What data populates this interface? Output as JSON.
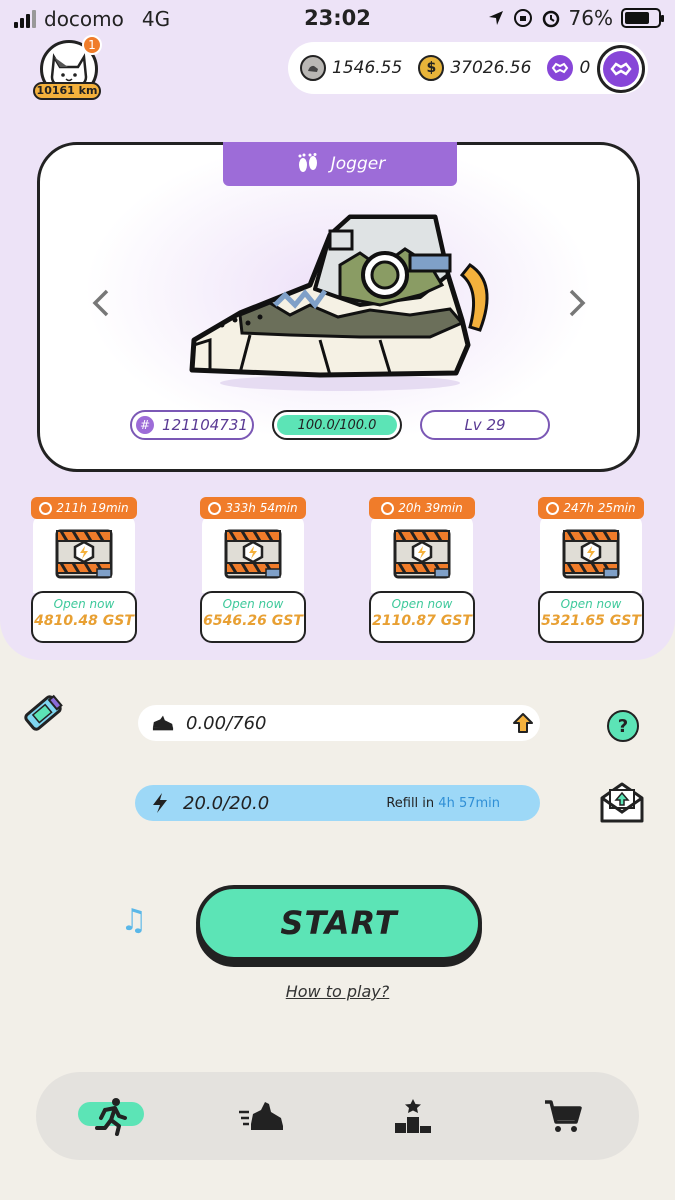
{
  "status_bar": {
    "carrier": "docomo",
    "network": "4G",
    "time": "23:02",
    "battery": "76%",
    "battery_level": 0.76
  },
  "profile": {
    "badge_count": "1",
    "distance": "10161 km"
  },
  "currencies": {
    "gmt": "1546.55",
    "gst": "37026.56",
    "polygon": "0"
  },
  "sneaker": {
    "type": "Jogger",
    "id": "121104731",
    "durability": "100.0/100.0",
    "level": "Lv 29"
  },
  "mystery_boxes": [
    {
      "timer": "211h 19min",
      "open_label": "Open now",
      "amount": "4810.48 GST"
    },
    {
      "timer": "333h 54min",
      "open_label": "Open now",
      "amount": "6546.26 GST"
    },
    {
      "timer": "20h 39min",
      "open_label": "Open now",
      "amount": "2110.87 GST"
    },
    {
      "timer": "247h 25min",
      "open_label": "Open now",
      "amount": "5321.65 GST"
    }
  ],
  "steps": "0.00/760",
  "energy": {
    "value": "20.0/20.0",
    "refill_label": "Refill in",
    "refill_time": "4h 57min"
  },
  "help_label": "?",
  "start_label": "START",
  "how_to_play": "How to play?",
  "bottom_nav": [
    "run-icon",
    "sneaker-icon",
    "leaderboard-icon",
    "cart-icon"
  ],
  "colors": {
    "accent_purple": "#9d6cd8",
    "accent_green": "#5ce4b6",
    "timer_orange": "#f07c2a",
    "energy_blue": "#9dd8f7"
  }
}
